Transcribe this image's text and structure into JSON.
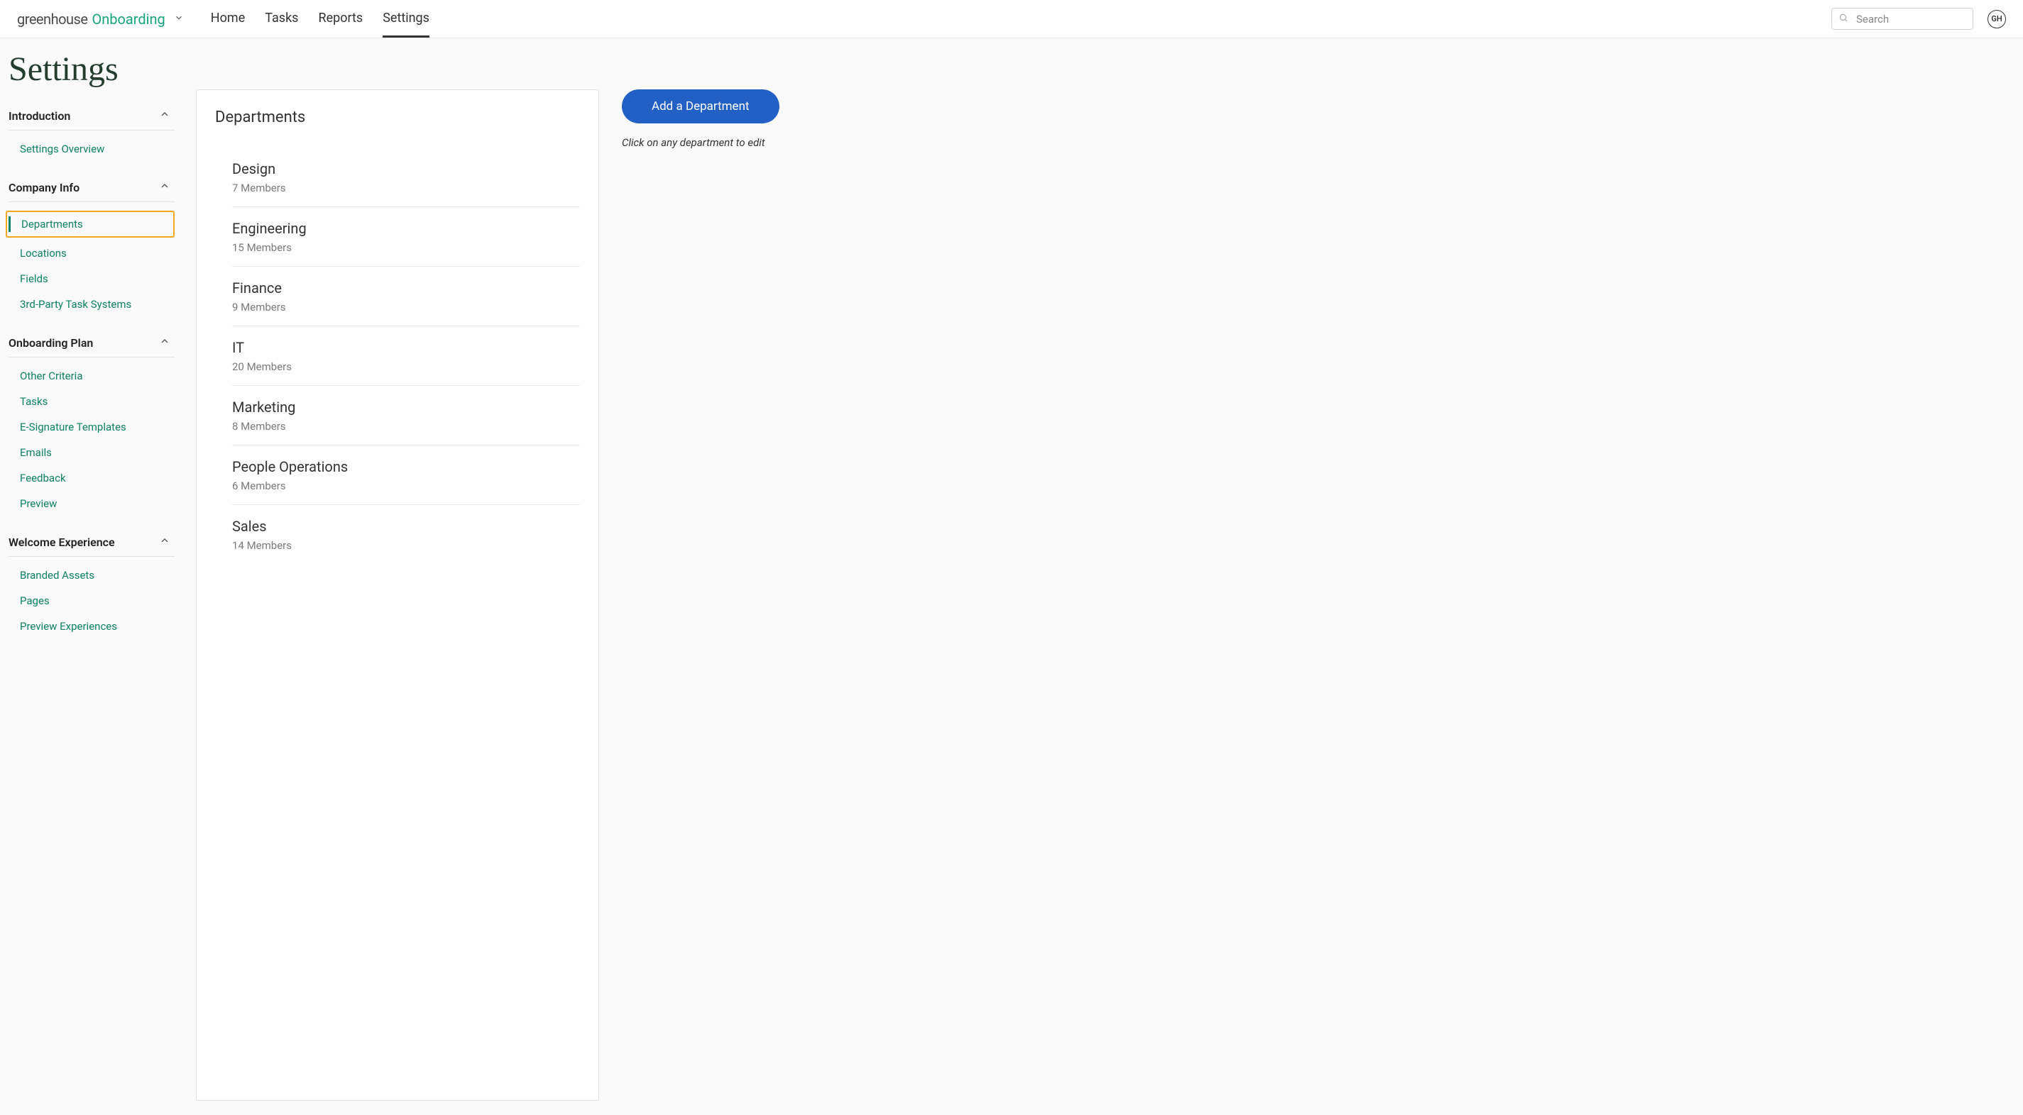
{
  "brand": {
    "word1": "greenhouse",
    "word2": "Onboarding"
  },
  "nav": {
    "home": "Home",
    "tasks": "Tasks",
    "reports": "Reports",
    "settings": "Settings"
  },
  "search": {
    "placeholder": "Search"
  },
  "avatar": {
    "initials": "GH"
  },
  "page": {
    "title": "Settings"
  },
  "sidebar": {
    "sections": {
      "introduction": {
        "title": "Introduction",
        "items": {
          "overview": "Settings Overview"
        }
      },
      "companyInfo": {
        "title": "Company Info",
        "items": {
          "departments": "Departments",
          "locations": "Locations",
          "fields": "Fields",
          "thirdParty": "3rd-Party Task Systems"
        }
      },
      "onboardingPlan": {
        "title": "Onboarding Plan",
        "items": {
          "otherCriteria": "Other Criteria",
          "tasks": "Tasks",
          "esignature": "E-Signature Templates",
          "emails": "Emails",
          "feedback": "Feedback",
          "preview": "Preview"
        }
      },
      "welcomeExperience": {
        "title": "Welcome Experience",
        "items": {
          "brandedAssets": "Branded Assets",
          "pages": "Pages",
          "previewExperiences": "Preview Experiences"
        }
      }
    }
  },
  "panel": {
    "title": "Departments",
    "departments": [
      {
        "name": "Design",
        "members": "7 Members"
      },
      {
        "name": "Engineering",
        "members": "15 Members"
      },
      {
        "name": "Finance",
        "members": "9 Members"
      },
      {
        "name": "IT",
        "members": "20 Members"
      },
      {
        "name": "Marketing",
        "members": "8 Members"
      },
      {
        "name": "People Operations",
        "members": "6 Members"
      },
      {
        "name": "Sales",
        "members": "14 Members"
      }
    ]
  },
  "actions": {
    "addButton": "Add a Department",
    "hint": "Click on any department to edit"
  }
}
